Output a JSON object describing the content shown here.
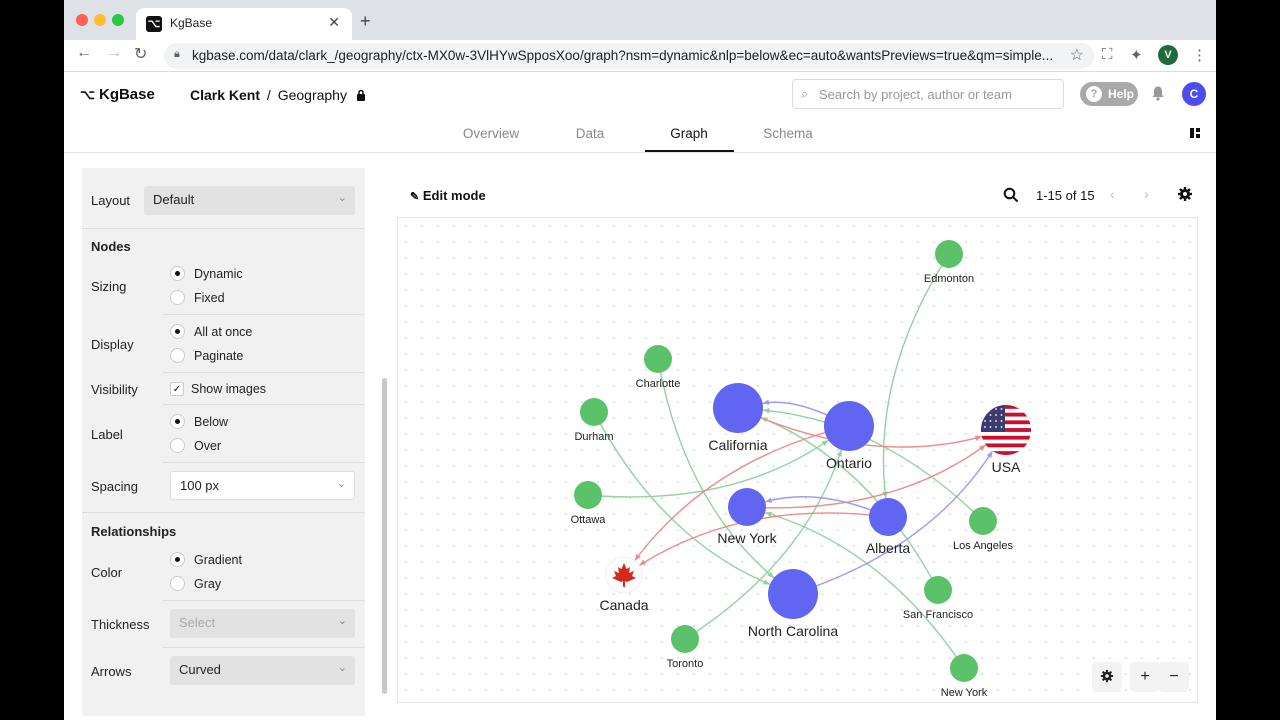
{
  "browser": {
    "tab_title": "KgBase",
    "url": "kgbase.com/data/clark_/geography/ctx-MX0w-3VlHYwSpposXoo/graph?nsm=dynamic&nlp=below&ec=auto&wantsPreviews=true&qm=simple...",
    "profile_initial": "V"
  },
  "header": {
    "logo_text": "KgBase",
    "owner": "Clark Kent",
    "separator": "/",
    "project": "Geography",
    "search_placeholder": "Search by project, author or team",
    "help_label": "Help",
    "avatar_initial": "C"
  },
  "tabs": [
    {
      "label": "Overview"
    },
    {
      "label": "Data"
    },
    {
      "label": "Graph"
    },
    {
      "label": "Schema"
    }
  ],
  "panel": {
    "layout_label": "Layout",
    "layout_value": "Default",
    "nodes_heading": "Nodes",
    "sizing_label": "Sizing",
    "sizing_options": [
      "Dynamic",
      "Fixed"
    ],
    "display_label": "Display",
    "display_options": [
      "All at once",
      "Paginate"
    ],
    "visibility_label": "Visibility",
    "show_images_label": "Show images",
    "label_label": "Label",
    "label_options": [
      "Below",
      "Over"
    ],
    "spacing_label": "Spacing",
    "spacing_value": "100 px",
    "relationships_heading": "Relationships",
    "color_label": "Color",
    "color_options": [
      "Gradient",
      "Gray"
    ],
    "thickness_label": "Thickness",
    "thickness_placeholder": "Select",
    "arrows_label": "Arrows",
    "arrows_value": "Curved"
  },
  "graph_toolbar": {
    "edit_mode_label": "Edit mode",
    "pager_text": "1-15 of 15"
  },
  "graph": {
    "colors": {
      "city": "#5cc26a",
      "state": "#6066f2",
      "edge_green": "#8fd4a0",
      "edge_blue": "#9a9cf0",
      "edge_red": "#ef8a8a"
    },
    "nodes": [
      {
        "id": "edmonton",
        "label": "Edmonton",
        "kind": "city"
      },
      {
        "id": "charlotte",
        "label": "Charlotte",
        "kind": "city"
      },
      {
        "id": "durham",
        "label": "Durham",
        "kind": "city"
      },
      {
        "id": "ottawa",
        "label": "Ottawa",
        "kind": "city"
      },
      {
        "id": "toronto",
        "label": "Toronto",
        "kind": "city"
      },
      {
        "id": "losangeles",
        "label": "Los Angeles",
        "kind": "city"
      },
      {
        "id": "sanfrancisco",
        "label": "San Francisco",
        "kind": "city"
      },
      {
        "id": "newyorkcity",
        "label": "New York",
        "kind": "city"
      },
      {
        "id": "california",
        "label": "California",
        "kind": "state"
      },
      {
        "id": "ontario",
        "label": "Ontario",
        "kind": "state"
      },
      {
        "id": "newyork",
        "label": "New York",
        "kind": "state"
      },
      {
        "id": "alberta",
        "label": "Alberta",
        "kind": "state"
      },
      {
        "id": "northcarolina",
        "label": "North Carolina",
        "kind": "state"
      },
      {
        "id": "usa",
        "label": "USA",
        "kind": "country-us"
      },
      {
        "id": "canada",
        "label": "Canada",
        "kind": "country-ca"
      }
    ],
    "edges": [
      {
        "from": "edmonton",
        "to": "alberta",
        "color": "green"
      },
      {
        "from": "charlotte",
        "to": "northcarolina",
        "color": "green"
      },
      {
        "from": "durham",
        "to": "northcarolina",
        "color": "green"
      },
      {
        "from": "ottawa",
        "to": "ontario",
        "color": "green"
      },
      {
        "from": "toronto",
        "to": "ontario",
        "color": "green"
      },
      {
        "from": "losangeles",
        "to": "california",
        "color": "green"
      },
      {
        "from": "sanfrancisco",
        "to": "california",
        "color": "green"
      },
      {
        "from": "newyorkcity",
        "to": "newyork",
        "color": "green"
      },
      {
        "from": "california",
        "to": "usa",
        "color": "red"
      },
      {
        "from": "ontario",
        "to": "canada",
        "color": "red"
      },
      {
        "from": "newyork",
        "to": "usa",
        "color": "red"
      },
      {
        "from": "alberta",
        "to": "canada",
        "color": "red"
      },
      {
        "from": "northcarolina",
        "to": "usa",
        "color": "blue"
      },
      {
        "from": "ontario",
        "to": "california",
        "color": "blue"
      },
      {
        "from": "alberta",
        "to": "newyork",
        "color": "blue"
      }
    ]
  },
  "zoom": {
    "plus": "+",
    "minus": "−"
  }
}
